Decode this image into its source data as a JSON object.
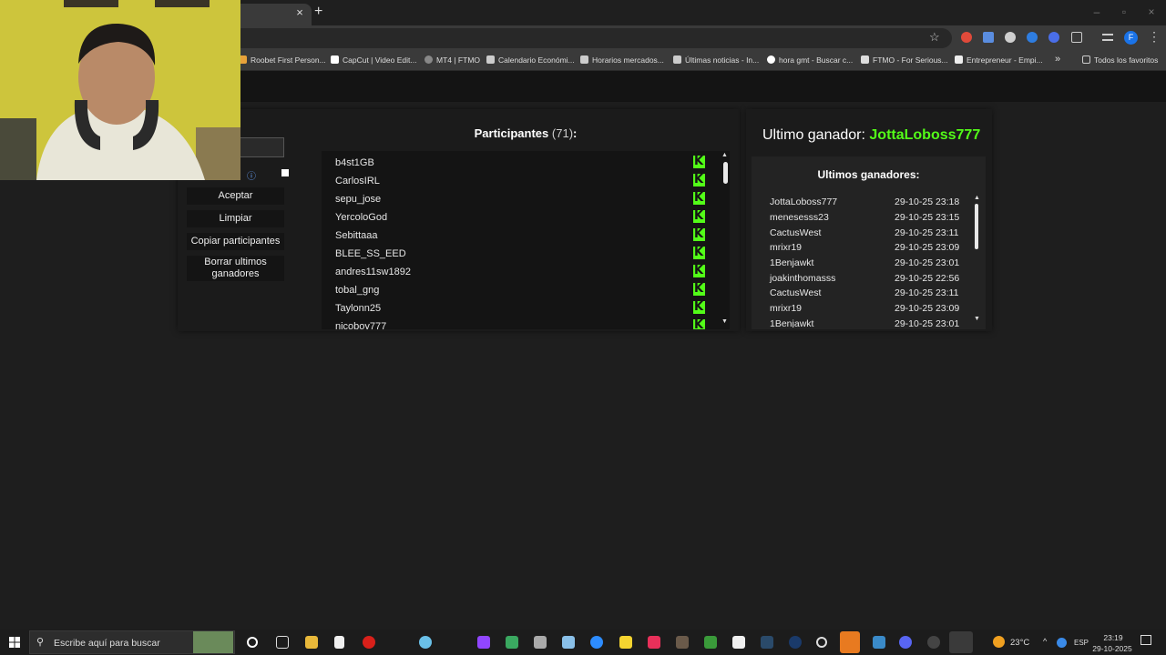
{
  "browser": {
    "tab_close": "×",
    "new_tab": "+",
    "bookmarks": [
      {
        "label": "Roobet First Person..."
      },
      {
        "label": "CapCut | Video Edit..."
      },
      {
        "label": "MT4 | FTMO"
      },
      {
        "label": "Calendario Económi..."
      },
      {
        "label": "Horarios mercados..."
      },
      {
        "label": "Últimas noticias - In..."
      },
      {
        "label": "hora gmt - Buscar c..."
      },
      {
        "label": "FTMO - For Serious..."
      },
      {
        "label": "Entrepreneur - Empi..."
      }
    ],
    "more_bookmarks": "»",
    "all_favorites": "Todos los favoritos",
    "profile_letter": "F"
  },
  "controls": {
    "accept": "Aceptar",
    "clear": "Limpiar",
    "copy_participants": "Copiar participantes",
    "delete_winners": "Borrar ultimos ganadores"
  },
  "participants": {
    "title": "Participantes",
    "count": "(71)",
    "colon": ":",
    "items": [
      "b4st1GB",
      "CarlosIRL",
      "sepu_jose",
      "YercoloGod",
      "Sebittaaa",
      "BLEE_SS_EED",
      "andres11sw1892",
      "tobal_gng",
      "Taylonn25",
      "nicoboy777"
    ]
  },
  "winner": {
    "label": "Ultimo ganador:",
    "name": "JottaLoboss777"
  },
  "winners_list": {
    "title": "Ultimos ganadores:",
    "items": [
      {
        "name": "JottaLoboss777",
        "time": "29-10-25 23:18"
      },
      {
        "name": "menesesss23",
        "time": "29-10-25 23:15"
      },
      {
        "name": "CactusWest",
        "time": "29-10-25 23:11"
      },
      {
        "name": "mrixr19",
        "time": "29-10-25 23:09"
      },
      {
        "name": "1Benjawkt",
        "time": "29-10-25 23:01"
      },
      {
        "name": "joakinthomasss",
        "time": "29-10-25 22:56"
      },
      {
        "name": "CactusWest",
        "time": "29-10-25 23:11"
      },
      {
        "name": "mrixr19",
        "time": "29-10-25 23:09"
      },
      {
        "name": "1Benjawkt",
        "time": "29-10-25 23:01"
      }
    ]
  },
  "taskbar": {
    "search_placeholder": "Escribe aquí para buscar",
    "weather": "23°C",
    "language": "ESP",
    "time": "23:19",
    "date": "29-10-2025"
  },
  "colors": {
    "accent_green": "#53fc18",
    "panel_bg": "#1b1b1b",
    "list_bg": "#141414"
  }
}
